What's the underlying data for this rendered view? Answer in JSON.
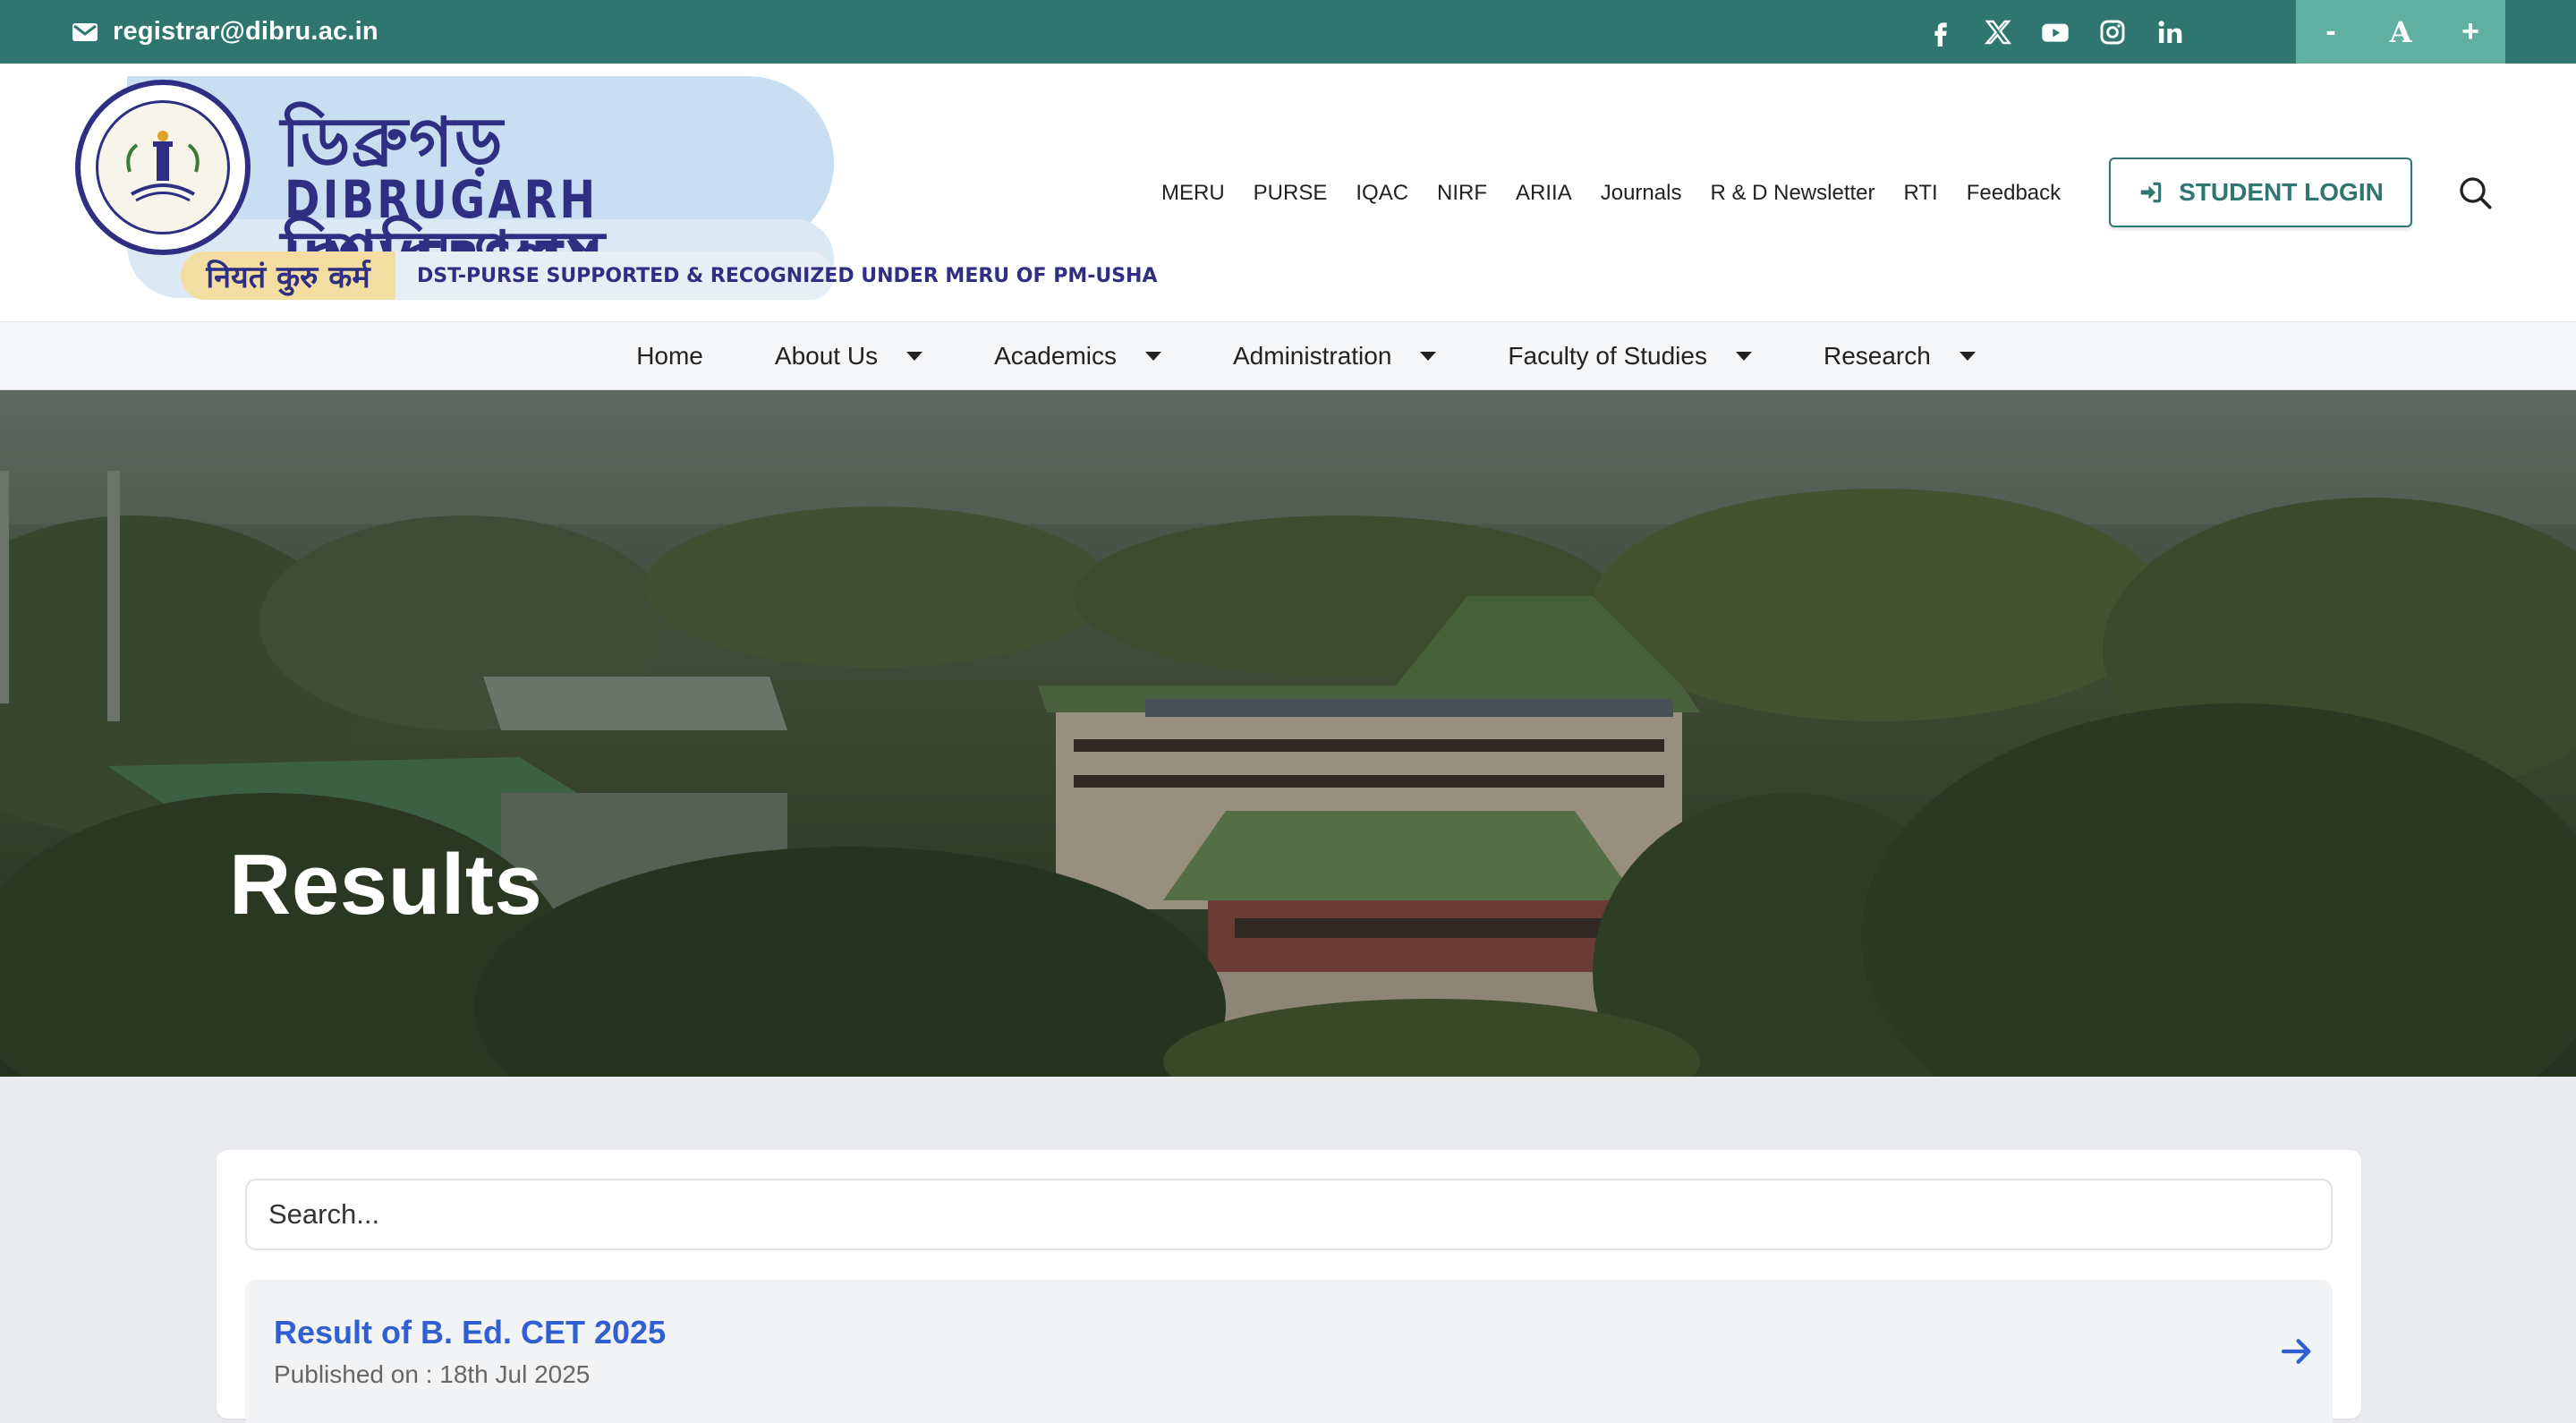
{
  "topbar": {
    "email": "registrar@dibru.ac.in",
    "social_icons": [
      "facebook-icon",
      "x-twitter-icon",
      "youtube-icon",
      "instagram-icon",
      "linkedin-icon"
    ],
    "font_controls": {
      "decrease": "-",
      "reset": "A",
      "increase": "+"
    },
    "colors": {
      "bar": "#2f7670",
      "font_controls_bg": "#5fb0a2"
    }
  },
  "logo": {
    "bengali_name": "ডিব্রুগড় বিশ্ববিদ্যালয়",
    "english_name": "DIBRUGARH UNIVERSITY",
    "motto": "नियतं कुरु कर्म",
    "tagline": "DST-PURSE SUPPORTED & RECOGNIZED UNDER MERU OF PM-USHA"
  },
  "quicklinks": [
    "MERU",
    "PURSE",
    "IQAC",
    "NIRF",
    "ARIIA",
    "Journals",
    "R & D Newsletter",
    "RTI",
    "Feedback"
  ],
  "login_button": "STUDENT LOGIN",
  "main_nav": [
    {
      "label": "Home",
      "dropdown": false
    },
    {
      "label": "About Us",
      "dropdown": true
    },
    {
      "label": "Academics",
      "dropdown": true
    },
    {
      "label": "Administration",
      "dropdown": true
    },
    {
      "label": "Faculty of Studies",
      "dropdown": true
    },
    {
      "label": "Research",
      "dropdown": true
    }
  ],
  "hero": {
    "title": "Results"
  },
  "results": {
    "search_placeholder": "Search...",
    "items": [
      {
        "title": "Result of B. Ed. CET 2025",
        "published": "Published on : 18th Jul 2025"
      }
    ],
    "colors": {
      "title": "#2f5fd0",
      "arrow": "#2f5fd0"
    }
  }
}
